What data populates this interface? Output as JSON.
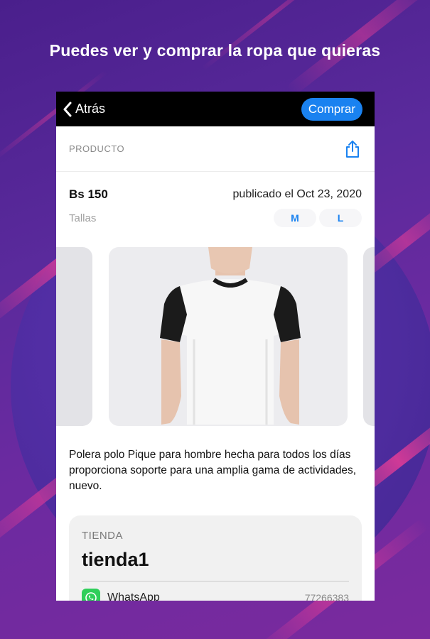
{
  "headline": "Puedes ver y comprar la ropa que quieras",
  "navbar": {
    "back_label": "Atrás",
    "buy_label": "Comprar"
  },
  "product": {
    "section_label": "PRODUCTO",
    "price": "Bs 150",
    "published": "publicado el Oct 23, 2020",
    "sizes_label": "Tallas",
    "sizes": [
      "M",
      "L"
    ],
    "description": "Polera polo Pique para hombre hecha para todos los días proporciona soporte para una amplia gama de actividades, nuevo."
  },
  "store": {
    "section_label": "TIENDA",
    "name": "tienda1",
    "contact_name": "WhatsApp",
    "contact_phone": "77266383"
  },
  "colors": {
    "accent": "#1a82f0",
    "whatsapp": "#2fcf5a",
    "navbar": "#000000"
  },
  "icons": [
    "chevron-left-icon",
    "share-icon",
    "whatsapp-icon"
  ]
}
